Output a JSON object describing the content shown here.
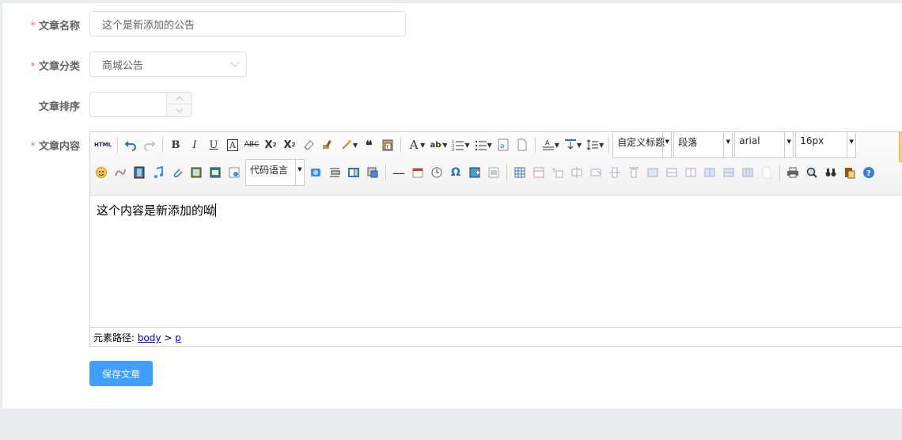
{
  "form": {
    "name": {
      "label": "文章名称",
      "required": true,
      "value": "这个是新添加的公告"
    },
    "category": {
      "label": "文章分类",
      "required": true,
      "value": "商城公告"
    },
    "sort": {
      "label": "文章排序",
      "required": false,
      "value": ""
    },
    "content": {
      "label": "文章内容",
      "required": true
    }
  },
  "editor": {
    "html_button": "HTML",
    "heading_select": "自定义标题",
    "paragraph_select": "段落",
    "font_family_select": "arial",
    "font_size_select": "16px",
    "code_language_select": "代码语言",
    "body_text": "这个内容是新添加的呦",
    "statusbar": {
      "label": "元素路径:",
      "path": [
        "body",
        "p"
      ],
      "separator": ">"
    }
  },
  "actions": {
    "save_label": "保存文章"
  },
  "colors": {
    "primary": "#409eff",
    "required": "#f56c6c",
    "label": "#606266"
  },
  "required_mark": "*"
}
